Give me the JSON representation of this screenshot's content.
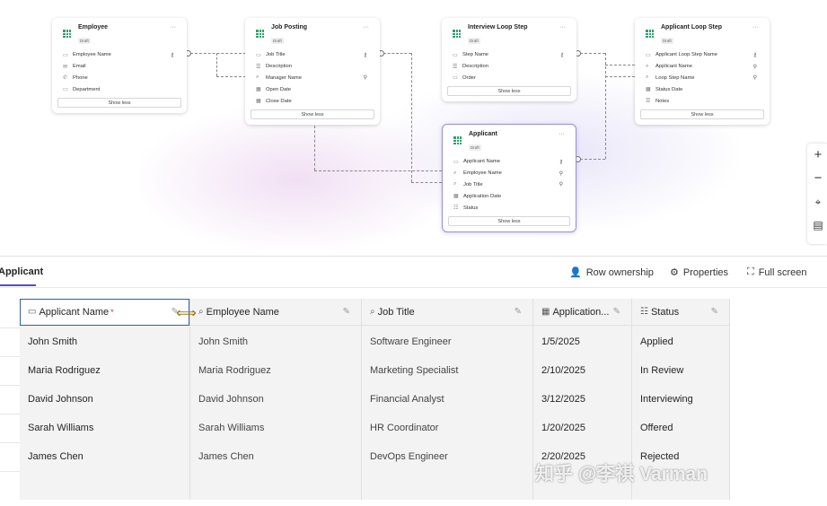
{
  "diagram": {
    "tables": [
      {
        "title": "Employee",
        "badge": "Draft",
        "fields": [
          {
            "name": "Employee Name",
            "icon": "text",
            "right": "key"
          },
          {
            "name": "Email",
            "icon": "email"
          },
          {
            "name": "Phone",
            "icon": "phone"
          },
          {
            "name": "Department",
            "icon": "text"
          }
        ],
        "button": "Show less"
      },
      {
        "title": "Job Posting",
        "badge": "Draft",
        "fields": [
          {
            "name": "Job Title",
            "icon": "text",
            "right": "key"
          },
          {
            "name": "Description",
            "icon": "multiline"
          },
          {
            "name": "Manager Name",
            "icon": "lookup",
            "right": "lookup"
          },
          {
            "name": "Open Date",
            "icon": "date"
          },
          {
            "name": "Close Date",
            "icon": "date"
          }
        ],
        "button": "Show less"
      },
      {
        "title": "Interview Loop Step",
        "badge": "Draft",
        "fields": [
          {
            "name": "Step Name",
            "icon": "text",
            "right": "key"
          },
          {
            "name": "Description",
            "icon": "multiline"
          },
          {
            "name": "Order",
            "icon": "text"
          }
        ],
        "button": "Show less"
      },
      {
        "title": "Applicant Loop Step",
        "badge": "Draft",
        "fields": [
          {
            "name": "Applicant Loop Step Name",
            "icon": "text",
            "right": "key"
          },
          {
            "name": "Applicant Name",
            "icon": "lookup",
            "right": "lookup"
          },
          {
            "name": "Loop Step Name",
            "icon": "lookup",
            "right": "lookup"
          },
          {
            "name": "Status Date",
            "icon": "date"
          },
          {
            "name": "Notes",
            "icon": "multiline"
          }
        ],
        "button": "Show less"
      },
      {
        "title": "Applicant",
        "badge": "Draft",
        "fields": [
          {
            "name": "Applicant Name",
            "icon": "text",
            "right": "key"
          },
          {
            "name": "Employee Name",
            "icon": "lookup",
            "right": "lookup"
          },
          {
            "name": "Job Title",
            "icon": "lookup",
            "right": "lookup"
          },
          {
            "name": "Application Date",
            "icon": "date"
          },
          {
            "name": "Status",
            "icon": "choice"
          }
        ],
        "button": "Show less"
      }
    ]
  },
  "panel": {
    "tab": "Applicant",
    "actions": {
      "row_ownership": "Row ownership",
      "properties": "Properties",
      "full_screen": "Full screen"
    }
  },
  "grid": {
    "columns": [
      {
        "label": "Applicant Name",
        "required": "*",
        "icon": "text"
      },
      {
        "label": "Employee Name",
        "icon": "lookup"
      },
      {
        "label": "Job Title",
        "icon": "lookup"
      },
      {
        "label": "Application...",
        "icon": "date"
      },
      {
        "label": "Status",
        "icon": "choice"
      }
    ],
    "rows": [
      [
        "John Smith",
        "John Smith",
        "Software Engineer",
        "1/5/2025",
        "Applied"
      ],
      [
        "Maria Rodriguez",
        "Maria Rodriguez",
        "Marketing Specialist",
        "2/10/2025",
        "In Review"
      ],
      [
        "David Johnson",
        "David Johnson",
        "Financial Analyst",
        "3/12/2025",
        "Interviewing"
      ],
      [
        "Sarah Williams",
        "Sarah Williams",
        "HR Coordinator",
        "1/20/2025",
        "Offered"
      ],
      [
        "James Chen",
        "James Chen",
        "DevOps Engineer",
        "2/20/2025",
        "Rejected"
      ]
    ]
  },
  "watermark": "知乎 @李祺 Varman"
}
